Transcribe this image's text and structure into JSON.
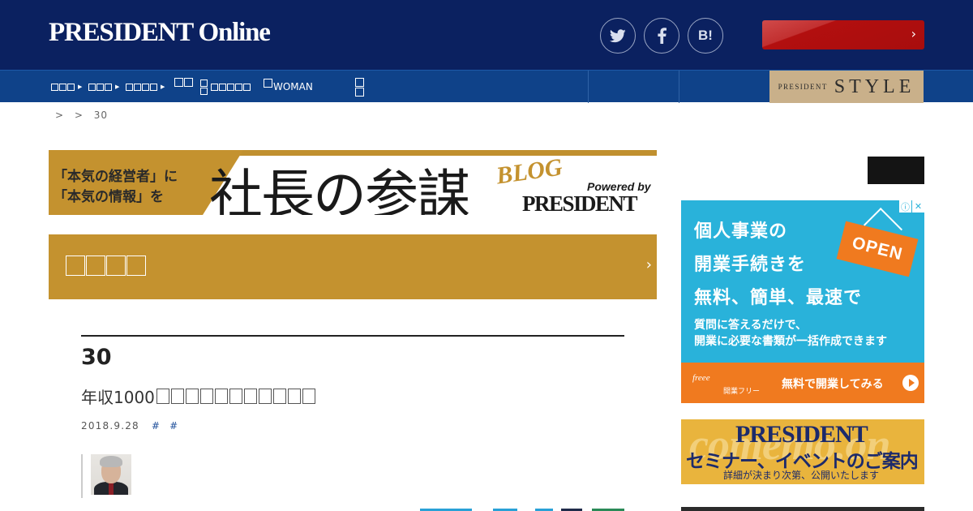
{
  "header": {
    "logo_main": "PRESIDENT",
    "logo_online": "Online",
    "social": [
      {
        "icon": "twitter-icon"
      },
      {
        "icon": "facebook-icon"
      },
      {
        "icon": "hatena-bookmark-icon",
        "label": "B!"
      }
    ],
    "promo_button": {
      "label": "",
      "chevron": "›",
      "color": "#b20f0f"
    }
  },
  "nav": {
    "items": [
      {
        "label": "",
        "has_arrow": true
      },
      {
        "label": "",
        "has_arrow": true
      },
      {
        "label": "",
        "has_arrow": true
      },
      {
        "label": ""
      },
      {
        "label": ""
      },
      {
        "label": "WOMAN"
      },
      {
        "label": ""
      }
    ],
    "style_banner": {
      "prefix": "PRESIDENT",
      "word": "STYLE"
    }
  },
  "breadcrumb": {
    "items": [
      ">",
      ">",
      "30"
    ]
  },
  "blog_banner": {
    "tagline_1": "「本気の経営者」に",
    "tagline_2": "「本気の情報」を",
    "title": "社長の参謀",
    "blog": "BLOG",
    "powered_by": "Powered by",
    "brand": "PRESIDENT"
  },
  "category_bar": {
    "label": "",
    "chevron": "›",
    "color": "#c4922f"
  },
  "article": {
    "number": "30",
    "title_prefix": "年収1000",
    "date": "2018.9.28",
    "tags": [
      "#",
      "#"
    ]
  },
  "sidebar": {
    "ad1": {
      "line1": "個人事業の",
      "line2": "開業手続きを",
      "line3": "無料、簡単、最速で",
      "sub1": "質問に答えるだけで、",
      "sub2": "開業に必要な書類が一括作成できます",
      "sign": "OPEN",
      "brand": "freee",
      "brand_sub": "開業フリー",
      "cta": "無料で開業してみる",
      "ad_info": "ⓘ",
      "ad_close": "✕",
      "colors": {
        "bg": "#29b2da",
        "accent": "#f07a1f"
      }
    },
    "ad2": {
      "ghost": "comemo.on",
      "brand": "PRESIDENT",
      "title": "セミナー、イベントのご案内",
      "note": "詳細が決まり次第、公開いたします"
    }
  },
  "colors": {
    "header_bg": "#0b2160",
    "nav_bg": "#0f4289",
    "gold": "#c4922f"
  }
}
